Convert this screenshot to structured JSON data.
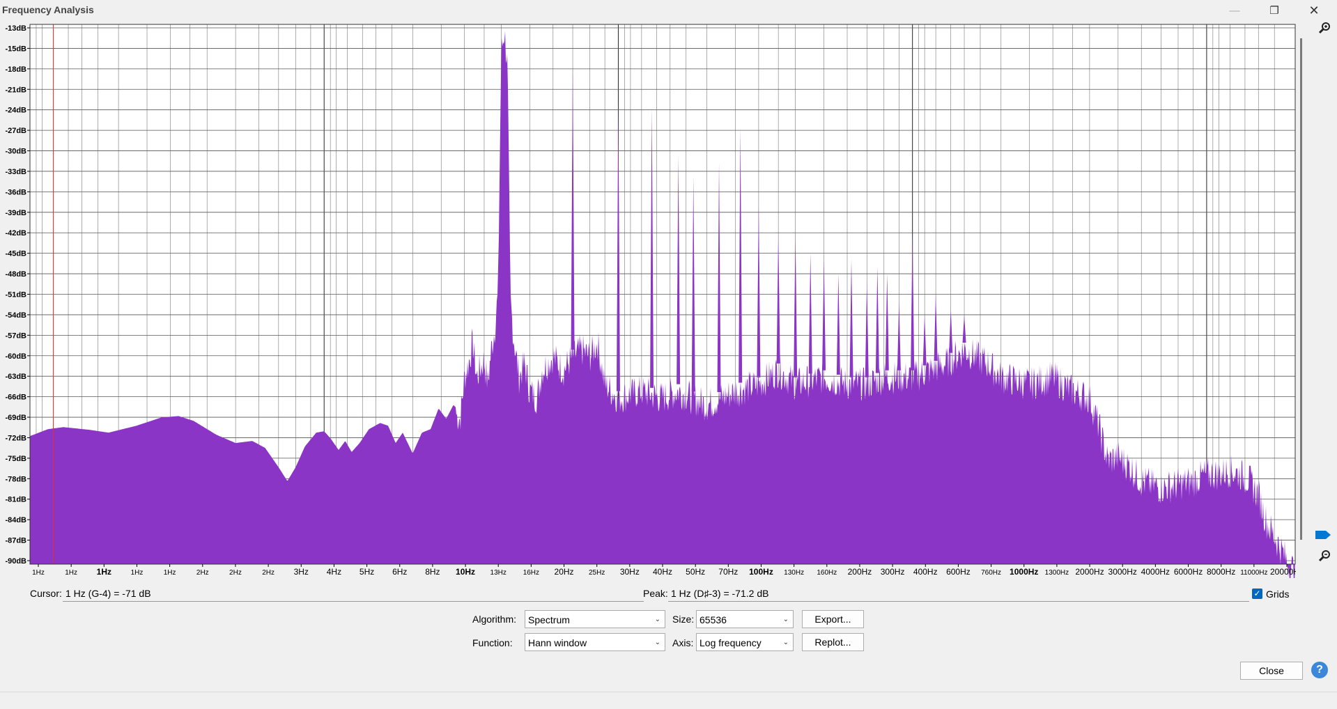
{
  "window": {
    "title": "Frequency Analysis"
  },
  "chart_data": {
    "type": "area",
    "x_scale": "log",
    "xlim_hz": [
      1,
      20000
    ],
    "ylim_db": [
      -91,
      -13
    ],
    "grid": true,
    "color": "#8a35c6",
    "y_ticks": [
      "-13dB",
      "-15dB",
      "-18dB",
      "-21dB",
      "-24dB",
      "-27dB",
      "-30dB",
      "-33dB",
      "-36dB",
      "-39dB",
      "-42dB",
      "-45dB",
      "-48dB",
      "-51dB",
      "-54dB",
      "-57dB",
      "-60dB",
      "-63dB",
      "-66dB",
      "-69dB",
      "-72dB",
      "-75dB",
      "-78dB",
      "-81dB",
      "-84dB",
      "-87dB",
      "-90dB"
    ],
    "x_ticks": [
      {
        "label": "1Hz",
        "major": false
      },
      {
        "label": "1Hz",
        "major": false
      },
      {
        "label": "1Hz",
        "major": true
      },
      {
        "label": "1Hz",
        "major": false
      },
      {
        "label": "1Hz",
        "major": false
      },
      {
        "label": "2Hz",
        "major": false
      },
      {
        "label": "2Hz",
        "major": false
      },
      {
        "label": "2Hz",
        "major": false
      },
      {
        "label": "3Hz",
        "major": false
      },
      {
        "label": "4Hz",
        "major": false
      },
      {
        "label": "5Hz",
        "major": false
      },
      {
        "label": "6Hz",
        "major": false
      },
      {
        "label": "8Hz",
        "major": false
      },
      {
        "label": "10Hz",
        "major": true
      },
      {
        "label": "13Hz",
        "major": false
      },
      {
        "label": "16Hz",
        "major": false
      },
      {
        "label": "20Hz",
        "major": false
      },
      {
        "label": "25Hz",
        "major": false
      },
      {
        "label": "30Hz",
        "major": false
      },
      {
        "label": "40Hz",
        "major": false
      },
      {
        "label": "50Hz",
        "major": false
      },
      {
        "label": "70Hz",
        "major": false
      },
      {
        "label": "100Hz",
        "major": true
      },
      {
        "label": "130Hz",
        "major": false
      },
      {
        "label": "160Hz",
        "major": false
      },
      {
        "label": "200Hz",
        "major": false
      },
      {
        "label": "300Hz",
        "major": false
      },
      {
        "label": "400Hz",
        "major": false
      },
      {
        "label": "600Hz",
        "major": false
      },
      {
        "label": "760Hz",
        "major": false
      },
      {
        "label": "1000Hz",
        "major": true
      },
      {
        "label": "1300Hz",
        "major": false
      },
      {
        "label": "2000Hz",
        "major": false
      },
      {
        "label": "3000Hz",
        "major": false
      },
      {
        "label": "4000Hz",
        "major": false
      },
      {
        "label": "6000Hz",
        "major": false
      },
      {
        "label": "8000Hz",
        "major": false
      },
      {
        "label": "11000Hz",
        "major": false
      },
      {
        "label": "20000Hz",
        "major": false
      }
    ],
    "envelope": [
      [
        1,
        -72.5
      ],
      [
        1.15,
        -71.5
      ],
      [
        1.3,
        -71.2
      ],
      [
        1.6,
        -71.6
      ],
      [
        1.85,
        -72
      ],
      [
        2.3,
        -71
      ],
      [
        2.8,
        -69.8
      ],
      [
        3.2,
        -69.6
      ],
      [
        3.6,
        -70.3
      ],
      [
        4.3,
        -72.3
      ],
      [
        5,
        -73.5
      ],
      [
        5.7,
        -73.2
      ],
      [
        6.3,
        -74.2
      ],
      [
        7,
        -77
      ],
      [
        7.5,
        -79
      ],
      [
        8,
        -77
      ],
      [
        8.6,
        -74
      ],
      [
        9.4,
        -72
      ],
      [
        10,
        -71.8
      ],
      [
        10.5,
        -72.8
      ],
      [
        11.2,
        -74.5
      ],
      [
        11.8,
        -73.2
      ],
      [
        12.4,
        -74.8
      ],
      [
        13.2,
        -73.5
      ],
      [
        14.2,
        -71.5
      ],
      [
        15.5,
        -70.6
      ],
      [
        16.5,
        -71
      ],
      [
        17.5,
        -73.5
      ],
      [
        18.5,
        -72
      ],
      [
        20,
        -75
      ],
      [
        21.5,
        -72
      ],
      [
        23,
        -71.5
      ],
      [
        24.5,
        -68.5
      ],
      [
        26,
        -70
      ],
      [
        27.5,
        -68
      ],
      [
        29,
        -69
      ],
      [
        30,
        -63
      ],
      [
        31,
        -61
      ],
      [
        32,
        -58
      ],
      [
        33,
        -63
      ],
      [
        35,
        -60.5
      ],
      [
        36,
        -64
      ],
      [
        37,
        -59
      ],
      [
        38,
        -56
      ],
      [
        39,
        -51
      ],
      [
        40,
        -16
      ],
      [
        41,
        -13
      ],
      [
        42,
        -18
      ],
      [
        43,
        -52
      ],
      [
        44,
        -57
      ],
      [
        46,
        -63
      ],
      [
        48,
        -61
      ],
      [
        50,
        -65
      ],
      [
        53,
        -66
      ],
      [
        55,
        -62
      ],
      [
        60,
        -60
      ],
      [
        65,
        -62
      ],
      [
        70,
        -60
      ],
      [
        75,
        -59
      ],
      [
        80,
        -60
      ],
      [
        85,
        -58
      ],
      [
        90,
        -64
      ],
      [
        100,
        -66
      ],
      [
        120,
        -65
      ],
      [
        140,
        -66
      ],
      [
        160,
        -65
      ],
      [
        200,
        -67
      ],
      [
        250,
        -65
      ],
      [
        300,
        -64
      ],
      [
        350,
        -62
      ],
      [
        400,
        -64
      ],
      [
        500,
        -63
      ],
      [
        600,
        -64
      ],
      [
        700,
        -64
      ],
      [
        800,
        -63
      ],
      [
        1000,
        -63
      ],
      [
        1300,
        -61
      ],
      [
        1500,
        -59
      ],
      [
        1800,
        -61
      ],
      [
        2000,
        -63
      ],
      [
        2500,
        -64
      ],
      [
        3000,
        -63
      ],
      [
        3500,
        -65
      ],
      [
        4000,
        -66
      ],
      [
        4300,
        -70
      ],
      [
        4600,
        -75
      ],
      [
        5000,
        -74.5
      ],
      [
        5500,
        -76
      ],
      [
        6000,
        -78
      ],
      [
        7000,
        -79
      ],
      [
        8000,
        -78.5
      ],
      [
        9000,
        -78
      ],
      [
        10000,
        -77
      ],
      [
        11000,
        -77
      ],
      [
        12000,
        -76.5
      ],
      [
        13000,
        -77
      ],
      [
        14000,
        -78
      ],
      [
        15000,
        -80
      ],
      [
        16000,
        -84
      ],
      [
        17000,
        -86
      ],
      [
        18000,
        -88
      ],
      [
        19000,
        -90
      ],
      [
        20000,
        -91
      ]
    ],
    "peaks": [
      [
        41,
        -13
      ],
      [
        70,
        -19
      ],
      [
        100,
        -24
      ],
      [
        130,
        -25
      ],
      [
        160,
        -32
      ],
      [
        180,
        -35
      ],
      [
        220,
        -33
      ],
      [
        260,
        -28
      ],
      [
        300,
        -39
      ],
      [
        350,
        -43
      ],
      [
        400,
        -43
      ],
      [
        450,
        -46
      ],
      [
        500,
        -47
      ],
      [
        560,
        -49
      ],
      [
        620,
        -47
      ],
      [
        700,
        -50
      ],
      [
        760,
        -48
      ],
      [
        820,
        -49
      ],
      [
        900,
        -53
      ],
      [
        1000,
        -43
      ],
      [
        1100,
        -55
      ],
      [
        1200,
        -52
      ],
      [
        1350,
        -54
      ],
      [
        1500,
        -55
      ]
    ],
    "cursor_hz": 1.2
  },
  "footer": {
    "cursor_label": "Cursor:",
    "cursor_value": "1 Hz (G-4) = -71 dB",
    "peak_label": "Peak:",
    "peak_value": "1 Hz (D♯-3) = -71.2 dB",
    "grids_label": "Grids",
    "grids_checked": true,
    "algorithm_label": "Algorithm:",
    "algorithm_value": "Spectrum",
    "function_label": "Function:",
    "function_value": "Hann window",
    "size_label": "Size:",
    "size_value": "65536",
    "axis_label": "Axis:",
    "axis_value": "Log frequency",
    "export_label": "Export...",
    "replot_label": "Replot...",
    "close_label": "Close",
    "help_label": "?"
  }
}
